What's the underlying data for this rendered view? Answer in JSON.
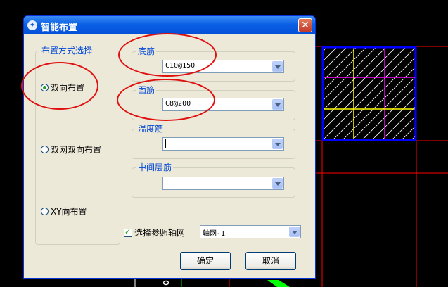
{
  "dialog": {
    "title": "智能布置",
    "close_symbol": "✕",
    "layout_group": {
      "label": "布置方式选择",
      "options": [
        {
          "label": "双向布置",
          "selected": true
        },
        {
          "label": "双网双向布置",
          "selected": false
        },
        {
          "label": "XY向布置",
          "selected": false
        }
      ]
    },
    "bottom_bar": {
      "label": "底筋",
      "value": "C10@150"
    },
    "top_bar": {
      "label": "面筋",
      "value": "C8@200"
    },
    "temp_bar": {
      "label": "温度筋",
      "value": ""
    },
    "middle_bar": {
      "label": "中间层筋",
      "value": ""
    },
    "axis_grid": {
      "checkbox_label": "选择参照轴网",
      "checked": true,
      "value": "轴网-1"
    },
    "ok_label": "确定",
    "cancel_label": "取消"
  },
  "colors": {
    "cad_background": "#000000",
    "cad_red": "#ff0000",
    "cad_blue": "#0000ff",
    "cad_magenta": "#ff00ff",
    "cad_yellow": "#ffff00",
    "cad_green": "#00ff00",
    "annotation_red": "#e01010"
  },
  "icons": {
    "title_icon": "app-icon",
    "close": "close-icon",
    "dropdown": "chevron-down-icon"
  }
}
